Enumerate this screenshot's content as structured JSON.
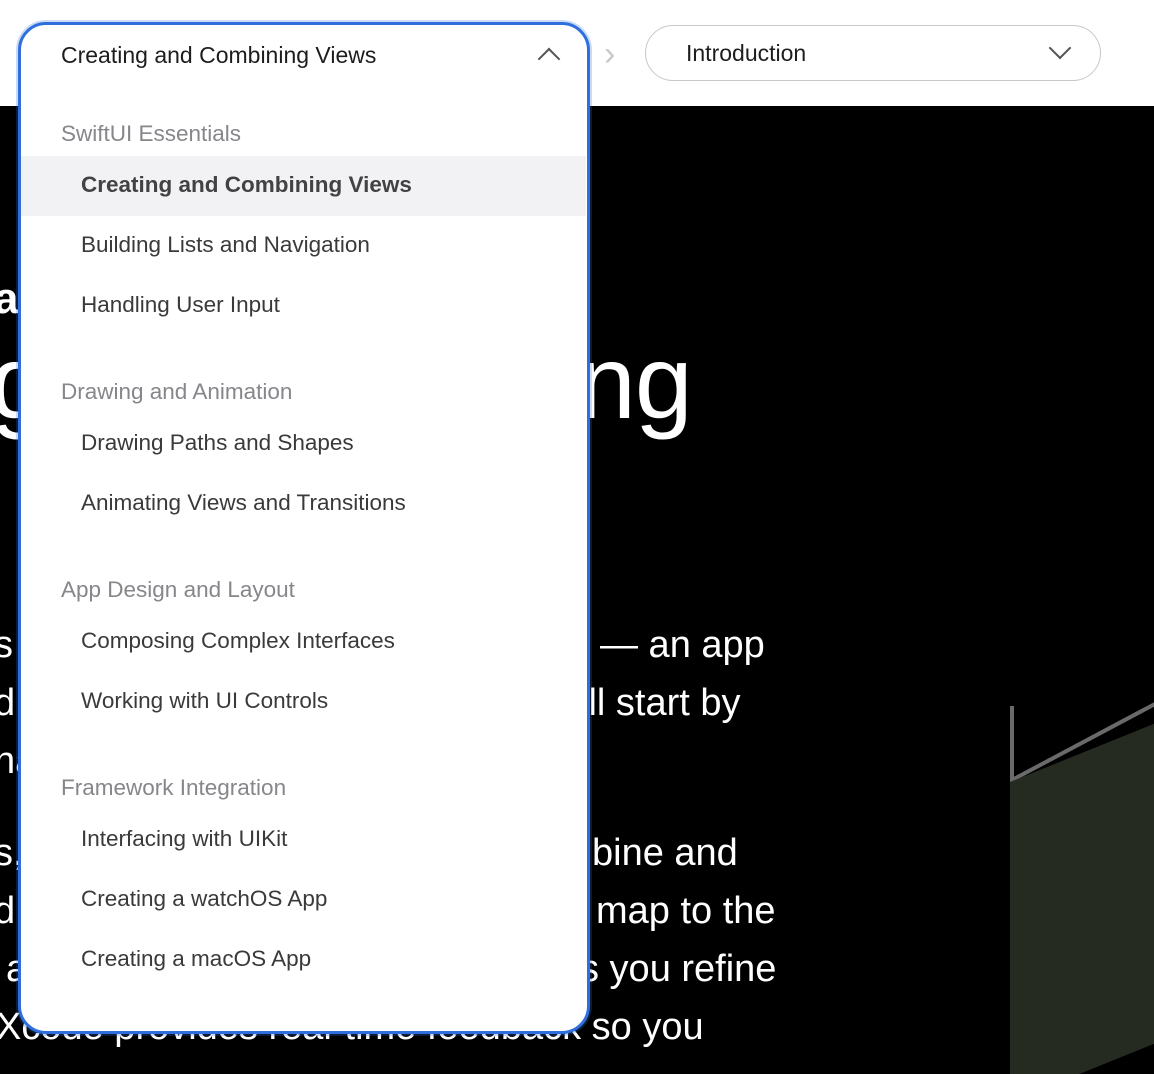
{
  "nav": {
    "project_select": {
      "value": "Creating and Combining Views"
    },
    "section_select": {
      "value": "Introduction"
    }
  },
  "dropdown": {
    "groups": [
      {
        "title": "SwiftUI Essentials",
        "items": [
          "Creating and Combining Views",
          "Building Lists and Navigation",
          "Handling User Input"
        ]
      },
      {
        "title": "Drawing and Animation",
        "items": [
          "Drawing Paths and Shapes",
          "Animating Views and Transitions"
        ]
      },
      {
        "title": "App Design and Layout",
        "items": [
          "Composing Complex Interfaces",
          "Working with UI Controls"
        ]
      },
      {
        "title": "Framework Integration",
        "items": [
          "Interfacing with UIKit",
          "Creating a watchOS App",
          "Creating a macOS App"
        ]
      }
    ],
    "selected_item": "Creating and Combining Views"
  },
  "hero": {
    "eyebrow_fragment": "a",
    "title_left_fragment": "g",
    "title_right_fragment": "ng",
    "para_fragments": [
      "s",
      "— an app",
      "d",
      "’ll start by",
      "na",
      "s,",
      "bine and",
      "d",
      "map to the",
      "a",
      "s you refine",
      "Xcode provides real-time feedback so you"
    ]
  },
  "colors": {
    "accent": "#2f6fdd",
    "hero_bg": "#000000",
    "selected_bg": "#f2f2f4"
  }
}
